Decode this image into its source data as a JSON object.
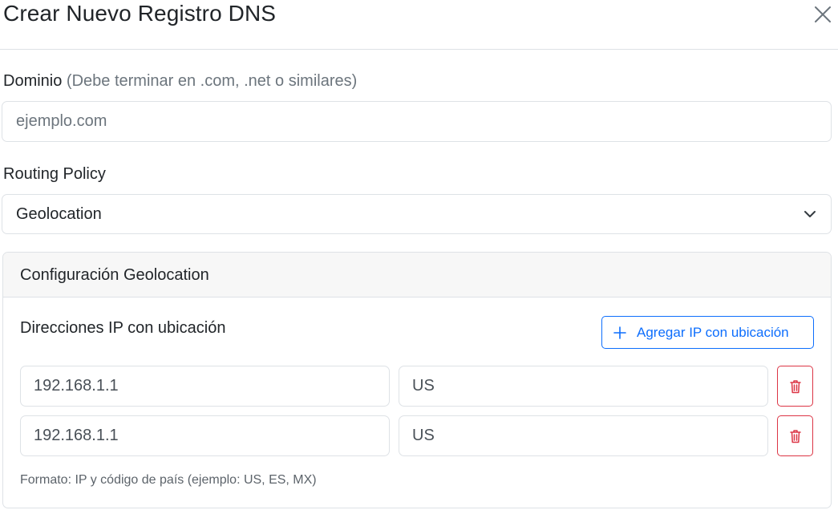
{
  "modal": {
    "title": "Crear Nuevo Registro DNS",
    "close_icon": "close-icon"
  },
  "domain": {
    "label": "Dominio",
    "hint": "(Debe terminar en .com, .net o similares)",
    "placeholder": "ejemplo.com",
    "value": ""
  },
  "routing": {
    "label": "Routing Policy",
    "selected": "Geolocation",
    "chevron_icon": "chevron-down-icon"
  },
  "geo_config": {
    "header": "Configuración Geolocation",
    "subtitle": "Direcciones IP con ubicación",
    "add_button_label": "Agregar IP con ubicación",
    "add_icon": "plus-icon",
    "entries": [
      {
        "ip": "192.168.1.1",
        "country": "US"
      },
      {
        "ip": "192.168.1.1",
        "country": "US"
      }
    ],
    "delete_icon": "trash-icon",
    "help": "Formato: IP y código de país (ejemplo: US, ES, MX)"
  },
  "colors": {
    "primary": "#0d6efd",
    "danger": "#dc3545",
    "border": "#dee2e6",
    "muted": "#6c757d",
    "card_header_bg": "#f7f7f7"
  }
}
